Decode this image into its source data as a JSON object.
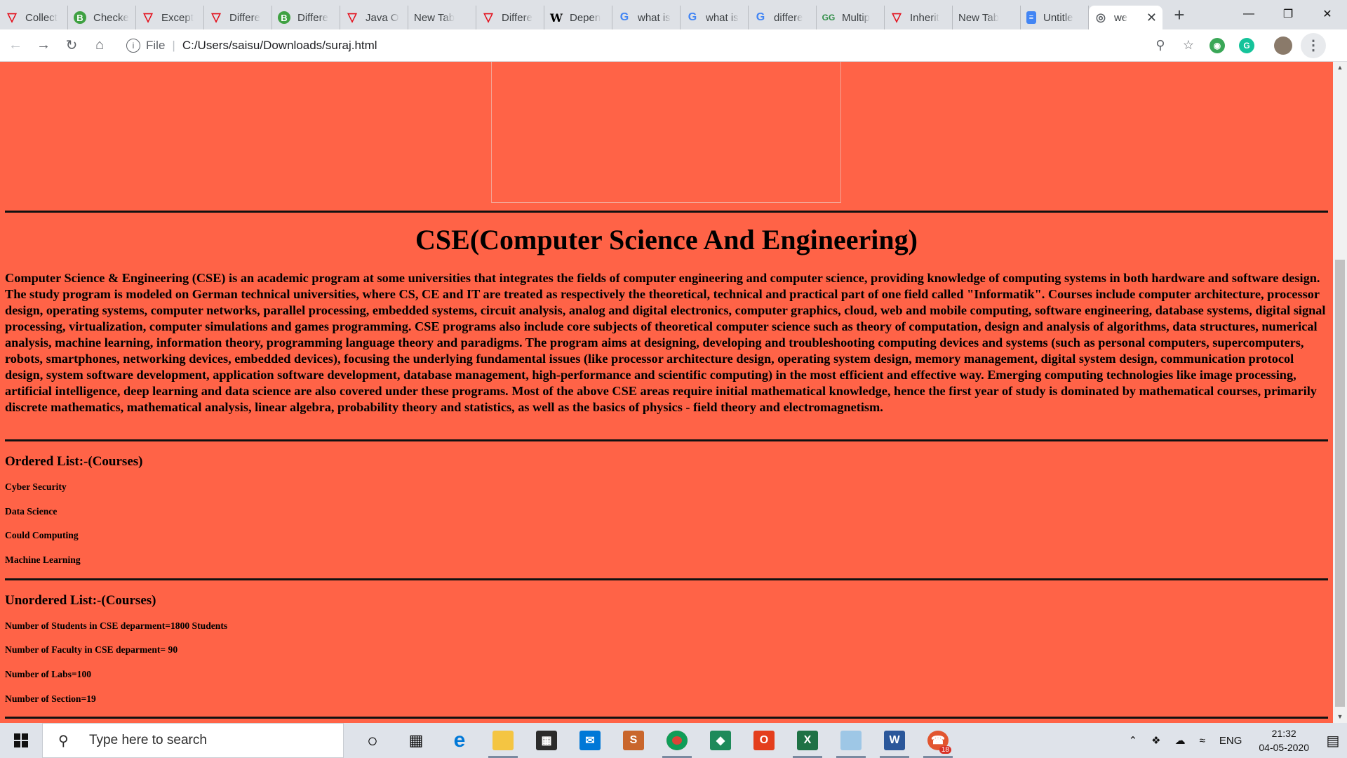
{
  "browser": {
    "tabs": [
      {
        "label": "Collect",
        "icon": "vivaldi-v-icon"
      },
      {
        "label": "Checke",
        "icon": "b-circle-icon"
      },
      {
        "label": "Except",
        "icon": "vivaldi-v-icon"
      },
      {
        "label": "Differe",
        "icon": "vivaldi-v-icon"
      },
      {
        "label": "Differe",
        "icon": "b-circle-icon"
      },
      {
        "label": "Java O",
        "icon": "vivaldi-v-icon"
      },
      {
        "label": "New Tab",
        "icon": "none"
      },
      {
        "label": "Differe",
        "icon": "vivaldi-v-icon"
      },
      {
        "label": "Depen",
        "icon": "wikipedia-w-icon"
      },
      {
        "label": "what is",
        "icon": "google-g-icon"
      },
      {
        "label": "what is",
        "icon": "google-g-icon"
      },
      {
        "label": "differe",
        "icon": "google-g-icon"
      },
      {
        "label": "Multip",
        "icon": "geeksforgeeks-icon"
      },
      {
        "label": "Inherit",
        "icon": "vivaldi-v-icon"
      },
      {
        "label": "New Tab",
        "icon": "none"
      },
      {
        "label": "Untitle",
        "icon": "google-docs-icon"
      },
      {
        "label": "we",
        "icon": "globe-icon",
        "active": true
      }
    ],
    "address": {
      "scheme": "File",
      "path": "C:/Users/saisu/Downloads/suraj.html"
    }
  },
  "page": {
    "heading": "CSE(Computer Science And Engineering)",
    "paragraph": "Computer Science & Engineering (CSE) is an academic program at some universities that integrates the fields of computer engineering and computer science, providing knowledge of computing systems in both hardware and software design. The study program is modeled on German technical universities, where CS, CE and IT are treated as respectively the theoretical, technical and practical part of one field called \"Informatik\". Courses include computer architecture, processor design, operating systems, computer networks, parallel processing, embedded systems, circuit analysis, analog and digital electronics, computer graphics, cloud, web and mobile computing, software engineering, database systems, digital signal processing, virtualization, computer simulations and games programming. CSE programs also include core subjects of theoretical computer science such as theory of computation, design and analysis of algorithms, data structures, numerical analysis, machine learning, information theory, programming language theory and paradigms. The program aims at designing, developing and troubleshooting computing devices and systems (such as personal computers, supercomputers, robots, smartphones, networking devices, embedded devices), focusing the underlying fundamental issues (like processor architecture design, operating system design, memory management, digital system design, communication protocol design, system software development, application software development, database management, high-performance and scientific computing) in the most efficient and effective way. Emerging computing technologies like image processing, artificial intelligence, deep learning and data science are also covered under these programs. Most of the above CSE areas require initial mathematical knowledge, hence the first year of study is dominated by mathematical courses, primarily discrete mathematics, mathematical analysis, linear algebra, probability theory and statistics, as well as the basics of physics - field theory and electromagnetism.",
    "ordered": {
      "title": "Ordered List:-(Courses)",
      "items": [
        "Cyber Security",
        "Data Science",
        "Could Computing",
        "Machine Learning"
      ]
    },
    "unordered": {
      "title": "Unordered List:-(Courses)",
      "items": [
        "Number of Students in CSE deparment=1800 Students",
        "Number of Faculty in CSE deparment= 90",
        "Number of Labs=100",
        "Number of Section=19"
      ]
    },
    "background_color": "#FF6347"
  },
  "taskbar": {
    "search_placeholder": "Type here to search",
    "whatsapp_badge": "18",
    "language": "ENG",
    "time": "21:32",
    "date": "04-05-2020"
  }
}
